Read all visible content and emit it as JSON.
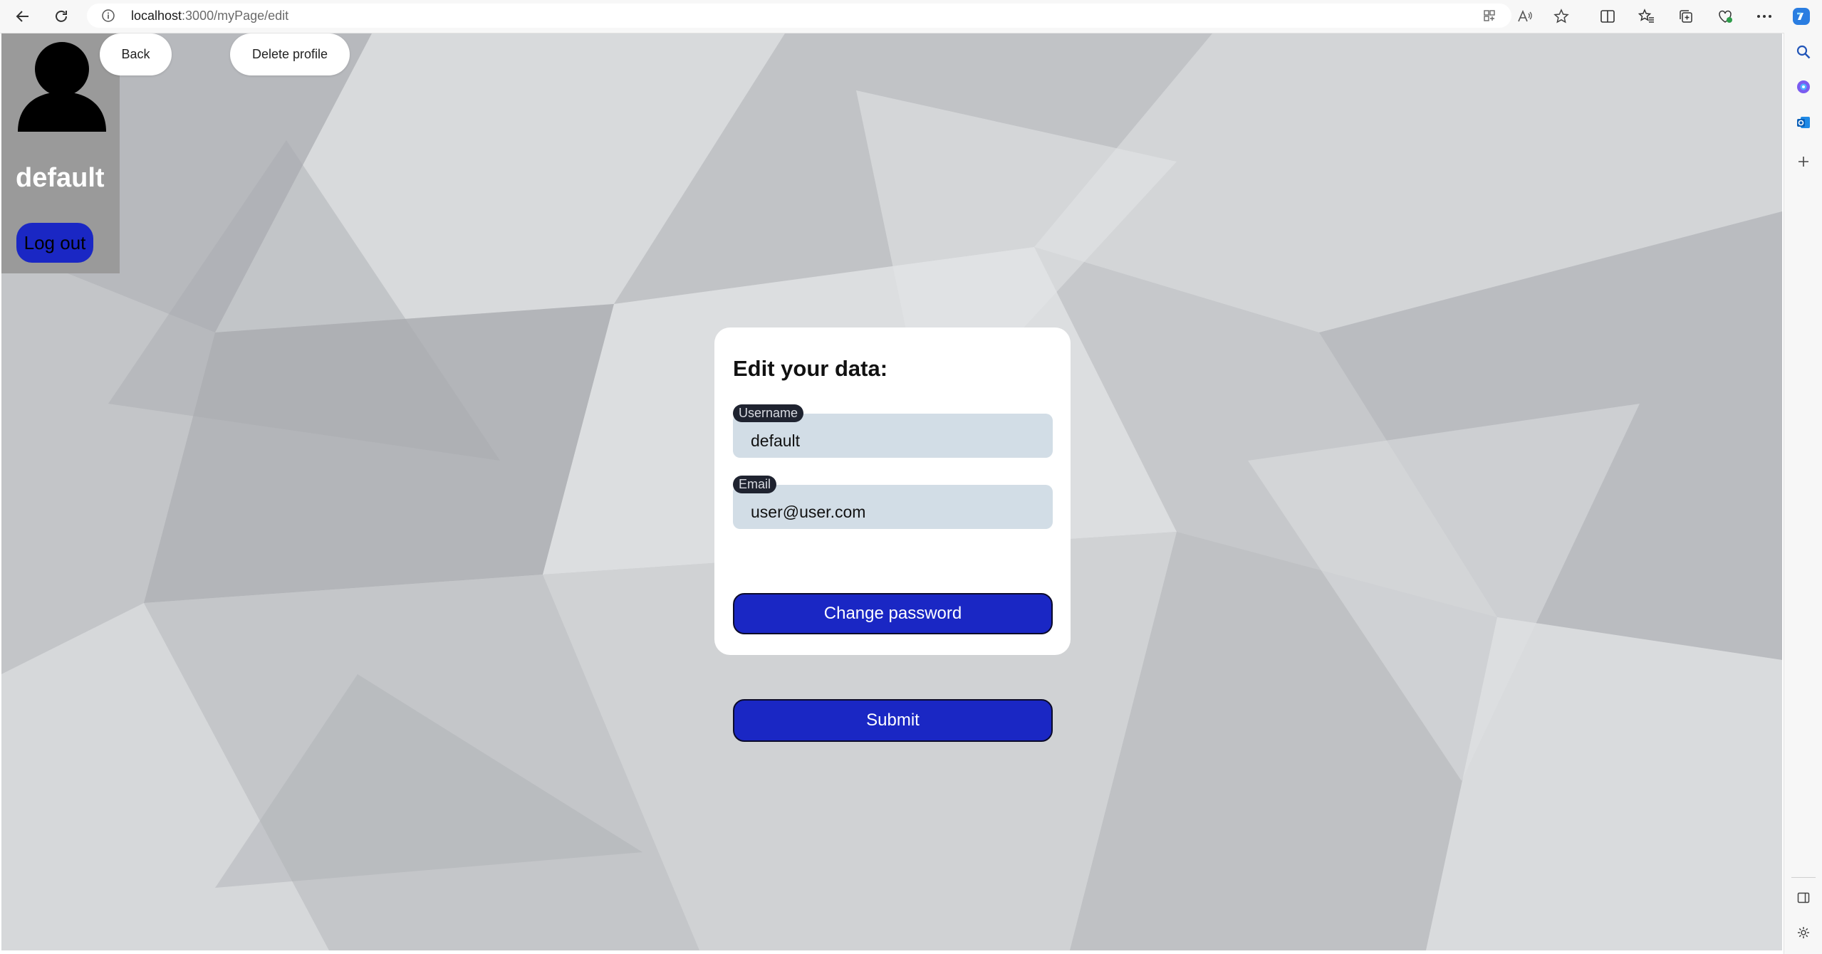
{
  "browser": {
    "url_host": "localhost",
    "url_path": ":3000/myPage/edit",
    "back_icon": "back-arrow-icon",
    "refresh_icon": "refresh-icon",
    "info_icon": "info-icon"
  },
  "sidebar_card": {
    "username": "default",
    "logout_label": "Log out",
    "avatar_icon": "person-silhouette-icon"
  },
  "top_buttons": {
    "back_label": "Back",
    "delete_label": "Delete profile"
  },
  "edit_form": {
    "title": "Edit your data:",
    "username_label": "Username",
    "username_value": "default",
    "email_label": "Email",
    "email_value": "user@user.com",
    "change_password_label": "Change password",
    "submit_label": "Submit"
  },
  "colors": {
    "primary_button": "#1a27c4",
    "field_background": "#d2dde6",
    "label_pill": "#1f2330",
    "user_card": "#9a9a9a"
  }
}
